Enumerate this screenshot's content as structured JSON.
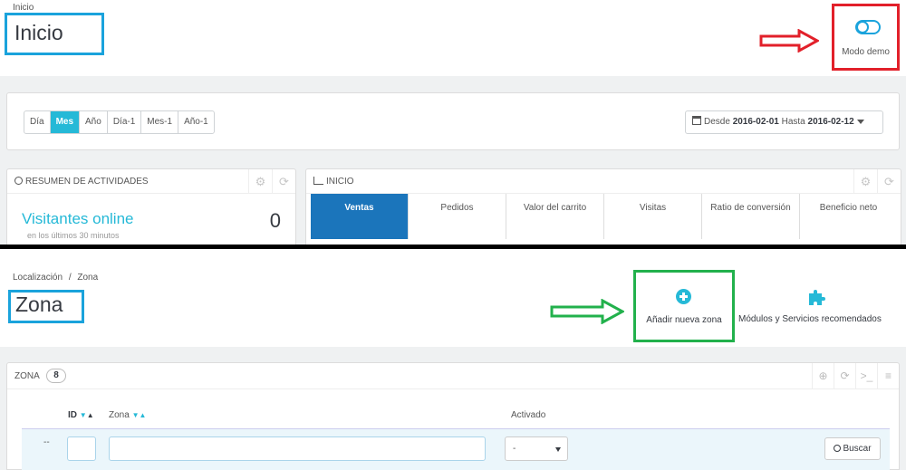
{
  "top": {
    "breadcrumb": "Inicio",
    "title": "Inicio",
    "demo_mode_label": "Modo demo",
    "periods": [
      "Día",
      "Mes",
      "Año",
      "Día-1",
      "Mes-1",
      "Año-1"
    ],
    "active_period": "Mes",
    "date_range": {
      "from_label": "Desde",
      "from": "2016-02-01",
      "to_label": "Hasta",
      "to": "2016-02-12"
    },
    "activity": {
      "title": "RESUMEN DE ACTIVIDADES",
      "visitors_label": "Visitantes online",
      "visitors_count": "0",
      "visitors_sub": "en los últimos 30 minutos"
    },
    "inicio": {
      "title": "INICIO",
      "kpis": [
        "Ventas",
        "Pedidos",
        "Valor del carrito",
        "Visitas",
        "Ratio de conversión",
        "Beneficio neto"
      ]
    }
  },
  "bottom": {
    "breadcrumb": [
      "Localización",
      "/",
      "Zona"
    ],
    "title": "Zona",
    "add_zone_label": "Añadir nueva zona",
    "modules_label": "Módulos y Servicios recomendados",
    "list": {
      "title": "ZONA",
      "count": "8",
      "columns": [
        "ID",
        "Zona",
        "Activado"
      ],
      "filter_dash": "--",
      "select_value": "-",
      "search_label": "Buscar"
    }
  },
  "colors": {
    "accent": "#25b9d7",
    "title_box": "#1aa3dc",
    "highlight_red": "#e2202a",
    "highlight_green": "#22b14c",
    "kpi_active": "#1b75bb"
  }
}
